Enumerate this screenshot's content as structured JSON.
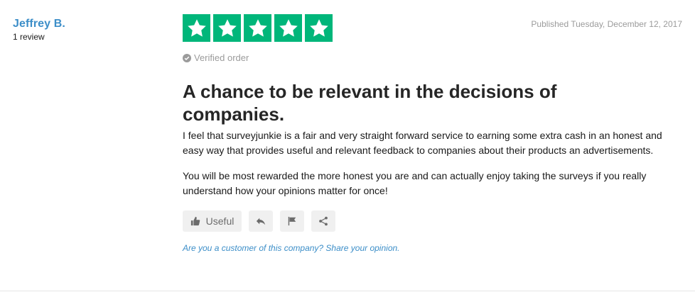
{
  "reviewer": {
    "name": "Jeffrey B.",
    "review_count": "1 review"
  },
  "rating": {
    "stars": 5,
    "max": 5,
    "color": "#00b67a"
  },
  "published": "Published Tuesday, December 12, 2017",
  "verified": {
    "label": "Verified order",
    "icon": "check-circle-icon"
  },
  "review": {
    "title": "A chance to be relevant in the decisions of companies.",
    "paragraphs": [
      "I feel that surveyjunkie is a fair and very straight forward service to earning some extra cash in an honest and easy way that provides useful and relevant feedback to companies about their products an advertisements.",
      "You will be most rewarded the more honest you are and can actually enjoy taking the surveys if you really understand how your opinions matter for once!"
    ]
  },
  "actions": {
    "useful_label": "Useful",
    "useful_icon": "thumbs-up-icon",
    "reply_icon": "reply-icon",
    "flag_icon": "flag-icon",
    "share_icon": "share-icon"
  },
  "customer_prompt": "Are you a customer of this company? Share your opinion.",
  "colors": {
    "link": "#3c8ec8",
    "muted": "#9b9b9b",
    "button_bg": "#f0f0f0"
  }
}
